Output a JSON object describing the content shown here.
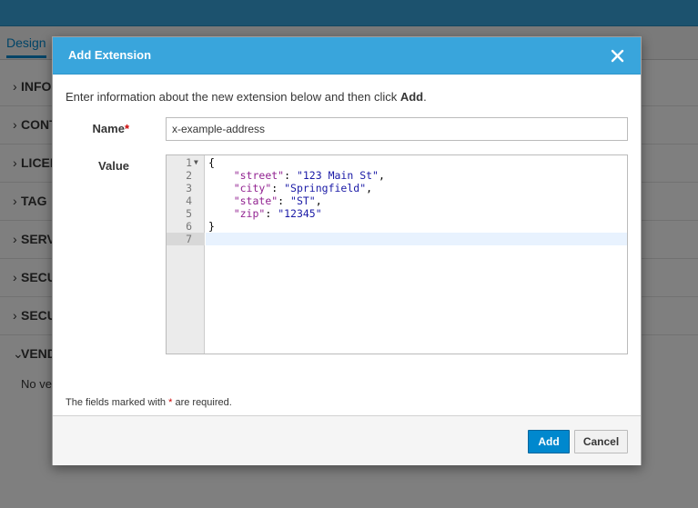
{
  "background": {
    "tabs": [
      {
        "label": "Design"
      }
    ],
    "sections": [
      {
        "label": "INFO",
        "chevron": "›"
      },
      {
        "label": "CONT",
        "chevron": "›"
      },
      {
        "label": "LICEN",
        "chevron": "›"
      },
      {
        "label": "TAG",
        "chevron": "›"
      },
      {
        "label": "SERV",
        "chevron": "›"
      },
      {
        "label": "SECU",
        "chevron": "›"
      },
      {
        "label": "SECU",
        "chevron": "›"
      },
      {
        "label": "VEND",
        "chevron": "⌄"
      }
    ],
    "vendor_empty_text": "No ve"
  },
  "modal": {
    "title": "Add Extension",
    "close_icon": "close-icon",
    "intro_text": "Enter information about the new extension below and then click ",
    "intro_bold": "Add",
    "intro_end": ".",
    "name_label": "Name",
    "name_required_mark": "*",
    "name_value": "x-example-address",
    "value_label": "Value",
    "editor_lines": [
      {
        "num": "1",
        "text": "{"
      },
      {
        "num": "2",
        "text": "    \"street\": \"123 Main St\","
      },
      {
        "num": "3",
        "text": "    \"city\": \"Springfield\","
      },
      {
        "num": "4",
        "text": "    \"state\": \"ST\","
      },
      {
        "num": "5",
        "text": "    \"zip\": \"12345\""
      },
      {
        "num": "6",
        "text": "}"
      },
      {
        "num": "7",
        "text": ""
      }
    ],
    "required_note_before": "The fields marked with ",
    "required_note_mark": "*",
    "required_note_after": " are required.",
    "buttons": {
      "add": "Add",
      "cancel": "Cancel"
    }
  },
  "colors": {
    "accent": "#39a5dc",
    "primary_button": "#0088ce",
    "required": "#cc0000",
    "json_key": "#922391",
    "json_string": "#1a1aa6"
  }
}
